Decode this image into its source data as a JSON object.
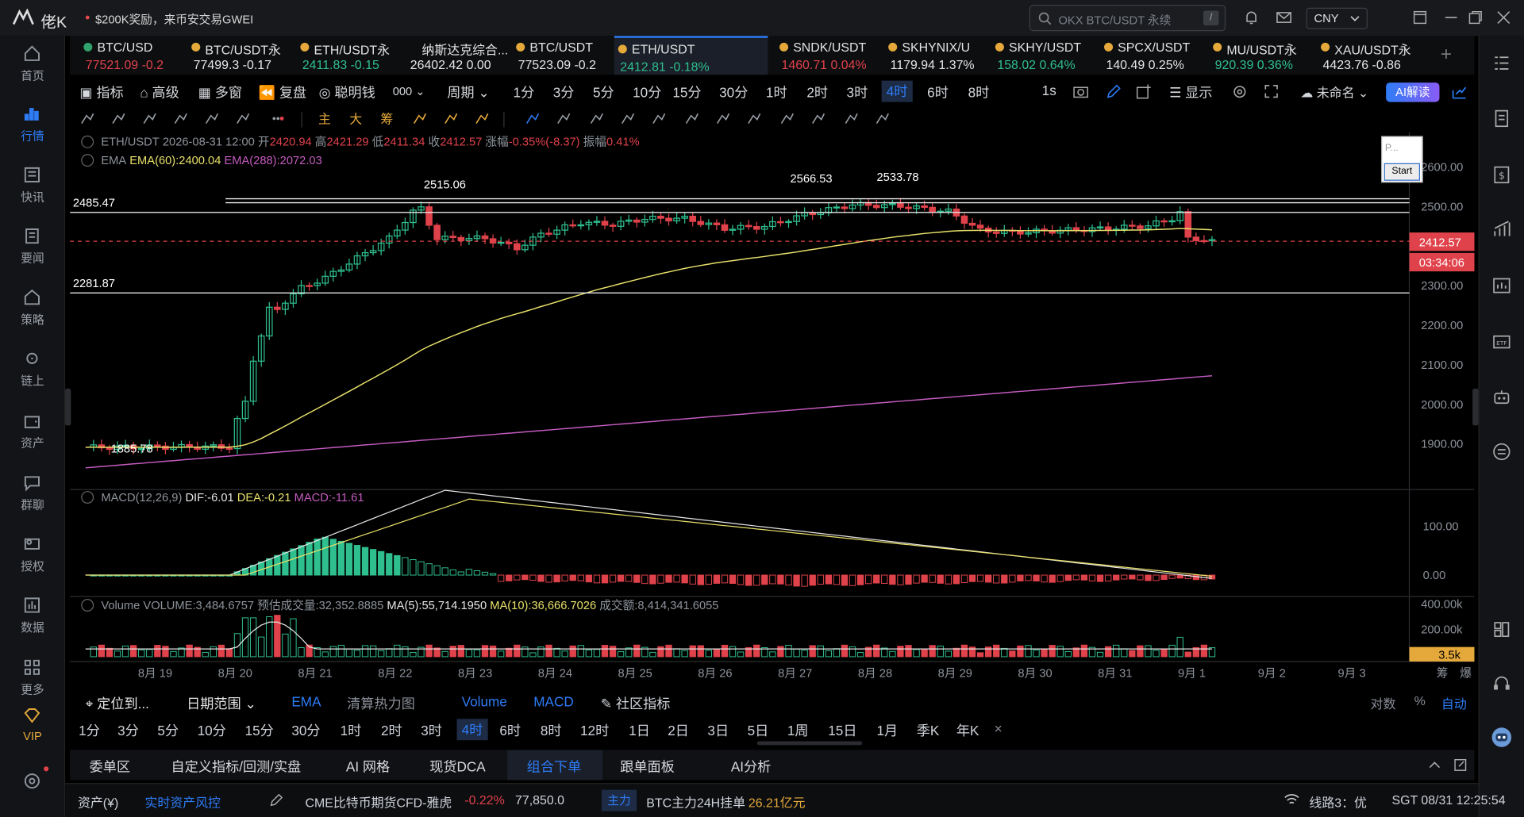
{
  "app": {
    "name": "佬K",
    "promo": "$200K奖励，来币安交易GWEI"
  },
  "search": {
    "placeholder": "OKX BTC/USDT 永续",
    "shortcut": "/"
  },
  "currency": {
    "value": "CNY"
  },
  "leftnav": [
    {
      "label": "首页",
      "icon": "home-icon"
    },
    {
      "label": "行情",
      "icon": "market-icon",
      "active": true
    },
    {
      "label": "快讯",
      "icon": "flash-news-icon"
    },
    {
      "label": "要闻",
      "icon": "news-icon"
    },
    {
      "label": "策略",
      "icon": "strategy-icon"
    },
    {
      "label": "链上",
      "icon": "onchain-icon"
    },
    {
      "label": "资产",
      "icon": "wallet-icon"
    },
    {
      "label": "群聊",
      "icon": "chat-icon"
    },
    {
      "label": "授权",
      "icon": "key-icon"
    },
    {
      "label": "数据",
      "icon": "data-icon"
    },
    {
      "label": "更多",
      "icon": "more-grid-icon"
    },
    {
      "label": "VIP",
      "icon": "vip-diamond-icon"
    }
  ],
  "tickers": [
    {
      "name": "BTC/USD",
      "price": "77521.09",
      "change": "-0.2",
      "dir": "down",
      "dot": "#2fa36b"
    },
    {
      "name": "BTC/USDT永",
      "price": "77499.3",
      "change": "-0.17",
      "dir": "neutral",
      "dot": "#e5a93b"
    },
    {
      "name": "ETH/USDT永",
      "price": "2411.83",
      "change": "-0.15",
      "dir": "up",
      "dot": "#e5a93b"
    },
    {
      "name": "纳斯达克综合...",
      "price": "26402.42",
      "change": "0.00",
      "dir": "neutral",
      "dot": ""
    },
    {
      "name": "BTC/USDT",
      "price": "77523.09",
      "change": "-0.2",
      "dir": "neutral",
      "dot": "#e5a93b"
    },
    {
      "name": "ETH/USDT",
      "price": "2412.81",
      "change": "-0.18%",
      "dir": "up",
      "dot": "#e5a93b",
      "active": true
    },
    {
      "name": "SNDK/USDT",
      "price": "1460.71",
      "change": "0.04%",
      "dir": "down",
      "dot": "#e5a93b"
    },
    {
      "name": "SKHYNIX/U",
      "price": "1179.94",
      "change": "1.37%",
      "dir": "neutral",
      "dot": "#e5a93b"
    },
    {
      "name": "SKHY/USDT",
      "price": "158.02",
      "change": "0.64%",
      "dir": "up",
      "dot": "#e5a93b"
    },
    {
      "name": "SPCX/USDT",
      "price": "140.49",
      "change": "0.25%",
      "dir": "neutral",
      "dot": "#e5a93b"
    },
    {
      "name": "MU/USDT永",
      "price": "920.39",
      "change": "0.36%",
      "dir": "up",
      "dot": "#e5a93b"
    },
    {
      "name": "XAU/USDT永",
      "price": "4423.76",
      "change": "-0.86",
      "dir": "neutral",
      "dot": "#e5a93b"
    }
  ],
  "toolbar": {
    "indicators": "指标",
    "advanced": "高级",
    "multi": "多窗",
    "replay": "复盘",
    "smart": "聪明钱",
    "unit": "000",
    "cycle": "周期",
    "periods": [
      "1分",
      "3分",
      "5分",
      "10分",
      "15分",
      "30分",
      "1时",
      "2时",
      "3时",
      "4时",
      "6时",
      "8时"
    ],
    "active_period": "4时",
    "second": "1s",
    "display": "显示",
    "unnamed": "未命名",
    "ai": "AI解读"
  },
  "chart_info": {
    "symbol": "ETH/USDT",
    "time": "2026-08-31 12:00",
    "open_label": "开",
    "open": "2420.94",
    "high_label": "高",
    "high": "2421.29",
    "low_label": "低",
    "low": "2411.34",
    "close_label": "收",
    "close": "2412.57",
    "change_label": "涨幅",
    "change": "-0.35%(-8.37)",
    "amp_label": "振幅",
    "amp": "0.41%",
    "ema_label": "EMA",
    "ema60": "EMA(60):2400.04",
    "ema288": "EMA(288):2072.03"
  },
  "macd_info": {
    "label": "MACD(12,26,9)",
    "dif": "DIF:-6.01",
    "dea": "DEA:-0.21",
    "macd": "MACD:-11.61"
  },
  "volume_info": {
    "label": "Volume",
    "volume": "VOLUME:3,484.6757",
    "est": "预估成交量:32,352.8885",
    "ma5": "MA(5):55,714.1950",
    "ma10": "MA(10):36,666.7026",
    "turnover": "成交额:8,414,341.6055"
  },
  "price_axis": [
    "2600.00",
    "2500.00",
    "2400.00",
    "2300.00",
    "2200.00",
    "2100.00",
    "2000.00",
    "1900.00"
  ],
  "current_price": "2412.57",
  "countdown": "03:34:06",
  "macd_axis": [
    "100.00",
    "0.00"
  ],
  "vol_axis": [
    "400.00k",
    "200.00k"
  ],
  "vol_current": "3.5k",
  "x_axis": [
    "8月 19",
    "8月 20",
    "8月 21",
    "8月 22",
    "8月 23",
    "8月 24",
    "8月 25",
    "8月 26",
    "8月 27",
    "8月 28",
    "8月 29",
    "8月 30",
    "8月 31",
    "9月 1",
    "9月 2",
    "9月 3"
  ],
  "x_axis_right": [
    "筹",
    "爆"
  ],
  "annotations": {
    "hline1": "2485.47",
    "hline2": "2281.87",
    "high1": "2515.06",
    "high2": "2566.53",
    "high3": "2533.78",
    "low1": "1885.78"
  },
  "start_widget": {
    "text": "P...",
    "button": "Start"
  },
  "bottom_tabs": {
    "locate": "定位到...",
    "range": "日期范围",
    "ema": "EMA",
    "heatmap": "清算热力图",
    "volume": "Volume",
    "macd": "MACD",
    "community": "社区指标",
    "log": "对数",
    "percent": "%",
    "auto": "自动"
  },
  "periods2": [
    "1分",
    "3分",
    "5分",
    "10分",
    "15分",
    "30分",
    "1时",
    "2时",
    "3时",
    "4时",
    "6时",
    "8时",
    "12时",
    "1日",
    "2日",
    "3日",
    "5日",
    "1周",
    "15日",
    "1月",
    "季K",
    "年K",
    "×"
  ],
  "panel_tabs": [
    "委单区",
    "自定义指标/回测/实盘",
    "AI 网格",
    "现货DCA",
    "组合下单",
    "跟单面板",
    "AI分析"
  ],
  "active_panel": "组合下单",
  "status": {
    "asset": "资产(¥)",
    "risk": "实时资产风控",
    "feed": "CME比特币期货CFD-雅虎",
    "feed_change": "-0.22%",
    "feed_price": "77,850.0",
    "tag": "主力",
    "main": "BTC主力24H挂单",
    "main_value": "26.21亿元",
    "line": "线路3：优",
    "clock": "SGT 08/31 12:25:54"
  },
  "colors": {
    "up": "#2fbf8f",
    "down": "#e0424b",
    "accent": "#2e7cf6",
    "ema60": "#e8e06a",
    "ema288": "#c45bc0"
  }
}
